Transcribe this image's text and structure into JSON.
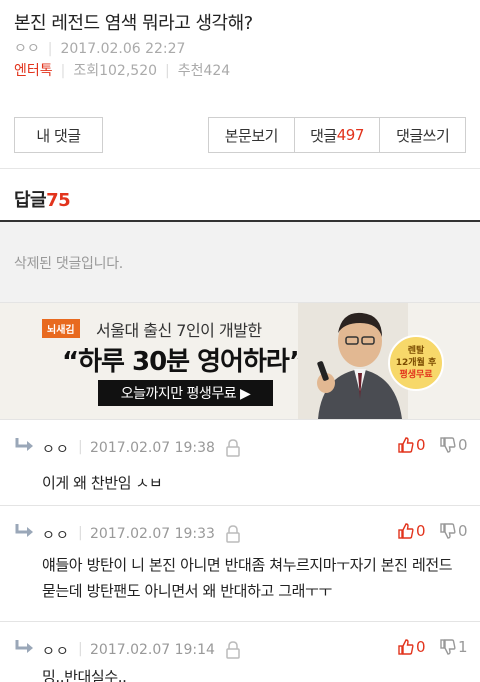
{
  "post": {
    "title": "본진 레전드 염색 뭐라고 생각해?",
    "author": "ㅇㅇ",
    "datetime": "2017.02.06 22:27",
    "category": "엔터톡",
    "views": "조회102,520",
    "recommends": "추천424"
  },
  "buttons": {
    "my_comments": "내 댓글",
    "view_post": "본문보기",
    "comments_label": "댓글",
    "comments_count": "497",
    "write_comment": "댓글쓰기"
  },
  "replies": {
    "label": "답글",
    "count": "75",
    "deleted_text": "삭제된 댓글입니다."
  },
  "ad": {
    "badge": "뇌새김",
    "line1": "서울대 출신 7인이 개발한",
    "line2": "“하루 30분 영어하라”",
    "cta": "오늘까지만 평생무료 ▶",
    "sticker_line1": "렌탈",
    "sticker_line2": "12개월 후",
    "sticker_line3": "평생무료",
    "accent": "#e86a1f"
  },
  "comments": [
    {
      "user": "ㅇㅇ",
      "date": "2017.02.07 19:38",
      "up": "0",
      "down": "0",
      "text": "이게 왜 찬반임 ㅅㅂ"
    },
    {
      "user": "ㅇㅇ",
      "date": "2017.02.07 19:33",
      "up": "0",
      "down": "0",
      "text": "얘들아 방탄이 니 본진 아니면 반대좀 쳐누르지마ㅜ자기 본진 레전드 묻는데 방탄팬도 아니면서 왜 반대하고 그래ㅜㅜ"
    },
    {
      "user": "ㅇㅇ",
      "date": "2017.02.07 19:14",
      "up": "0",
      "down": "1",
      "text": "밍..반대실수.."
    }
  ],
  "colors": {
    "accent_red": "#e2341d",
    "text_gray": "#999999"
  },
  "icons": [
    "reply-arrow-icon",
    "lock-icon",
    "thumbs-up-icon",
    "thumbs-down-icon"
  ]
}
